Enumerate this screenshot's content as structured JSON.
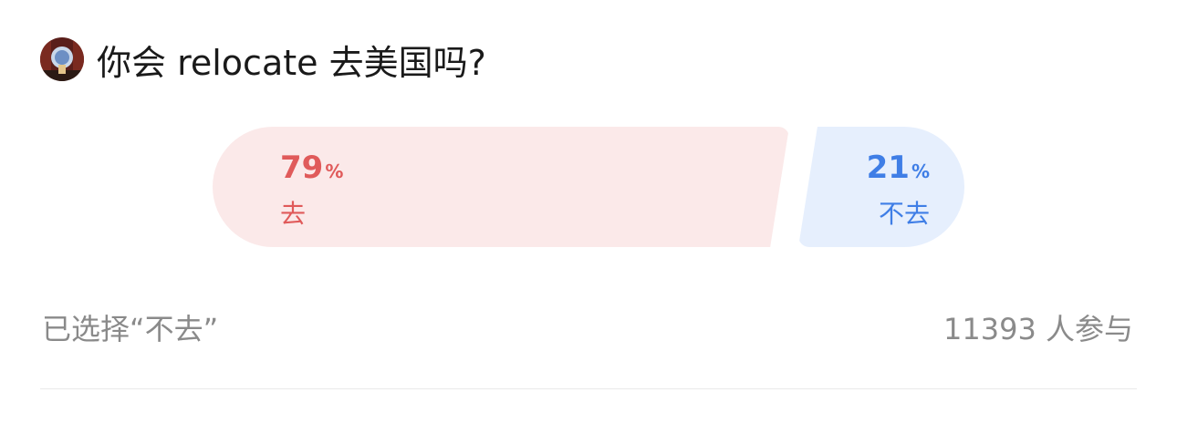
{
  "question": {
    "title": "你会 relocate 去美国吗?"
  },
  "poll": {
    "options": [
      {
        "label": "去",
        "percent": "79",
        "percent_sign": "%",
        "color": "#e05a5a",
        "bg": "#fbe9e9"
      },
      {
        "label": "不去",
        "percent": "21",
        "percent_sign": "%",
        "color": "#3f7ee6",
        "bg": "#e6effd"
      }
    ]
  },
  "footer": {
    "selected_text": "已选择“不去”",
    "participants": "11393 人参与"
  },
  "avatar": {
    "icon": "user-avatar-icon"
  }
}
